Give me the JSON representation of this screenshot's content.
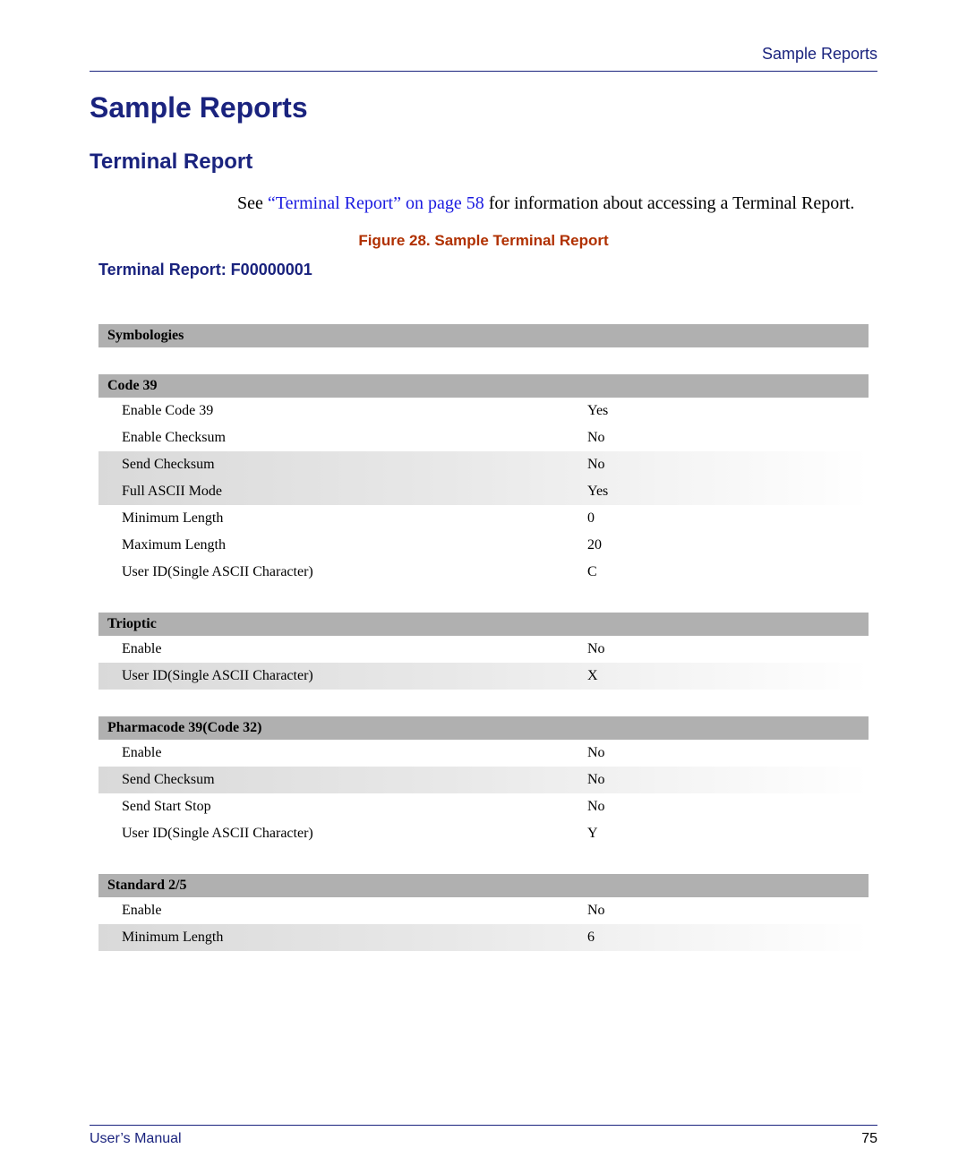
{
  "header": {
    "running_head": "Sample Reports"
  },
  "title": "Sample Reports",
  "subtitle": "Terminal Report",
  "intro": {
    "prefix": "See ",
    "link": "“Terminal Report” on page 58",
    "suffix": " for information about accessing a Terminal Report."
  },
  "figure_caption": "Figure 28. Sample Terminal Report",
  "report_title": "Terminal Report: F00000001",
  "sections": {
    "symbologies": {
      "header": "Symbologies"
    },
    "code39": {
      "header": "Code 39",
      "rows": [
        {
          "label": "Enable Code 39",
          "value": "Yes"
        },
        {
          "label": "Enable Checksum",
          "value": "No"
        },
        {
          "label": "Send Checksum",
          "value": "No"
        },
        {
          "label": "Full ASCII Mode",
          "value": "Yes"
        },
        {
          "label": "Minimum Length",
          "value": "0"
        },
        {
          "label": "Maximum Length",
          "value": "20"
        },
        {
          "label": "User ID(Single ASCII Character)",
          "value": "C"
        }
      ]
    },
    "trioptic": {
      "header": "Trioptic",
      "rows": [
        {
          "label": "Enable",
          "value": "No"
        },
        {
          "label": "User ID(Single ASCII Character)",
          "value": "X"
        }
      ]
    },
    "pharmacode": {
      "header": "Pharmacode 39(Code 32)",
      "rows": [
        {
          "label": "Enable",
          "value": "No"
        },
        {
          "label": "Send Checksum",
          "value": "No"
        },
        {
          "label": "Send Start Stop",
          "value": "No"
        },
        {
          "label": "User ID(Single ASCII Character)",
          "value": "Y"
        }
      ]
    },
    "standard25": {
      "header": "Standard 2/5",
      "rows": [
        {
          "label": "Enable",
          "value": "No"
        },
        {
          "label": "Minimum Length",
          "value": "6"
        }
      ]
    }
  },
  "footer": {
    "manual": "User’s Manual",
    "page": "75"
  }
}
